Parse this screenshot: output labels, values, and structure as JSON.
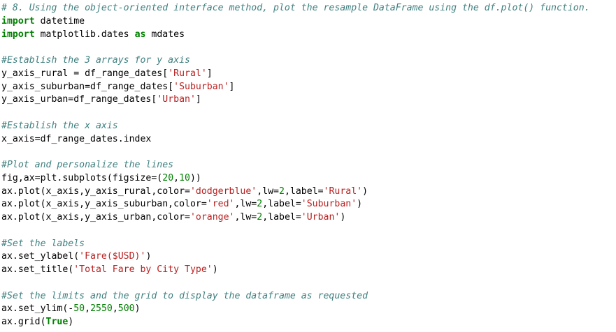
{
  "colors": {
    "comment": "#408080",
    "keyword": "#008000",
    "string": "#ba2121",
    "number": "#008000",
    "text": "#000000",
    "background": "#ffffff"
  },
  "code": {
    "lines": [
      [
        {
          "t": "comment",
          "v": "# 8. Using the object-oriented interface method, plot the resample DataFrame using the df.plot() function."
        }
      ],
      [
        {
          "t": "kw",
          "v": "import"
        },
        {
          "t": "name",
          "v": " datetime"
        }
      ],
      [
        {
          "t": "kw",
          "v": "import"
        },
        {
          "t": "name",
          "v": " matplotlib.dates "
        },
        {
          "t": "kw",
          "v": "as"
        },
        {
          "t": "name",
          "v": " mdates"
        }
      ],
      [],
      [
        {
          "t": "comment",
          "v": "#Establish the 3 arrays for y axis"
        }
      ],
      [
        {
          "t": "name",
          "v": "y_axis_rural = df_range_dates["
        },
        {
          "t": "str",
          "v": "'Rural'"
        },
        {
          "t": "name",
          "v": "]"
        }
      ],
      [
        {
          "t": "name",
          "v": "y_axis_suburban=df_range_dates["
        },
        {
          "t": "str",
          "v": "'Suburban'"
        },
        {
          "t": "name",
          "v": "]"
        }
      ],
      [
        {
          "t": "name",
          "v": "y_axis_urban=df_range_dates["
        },
        {
          "t": "str",
          "v": "'Urban'"
        },
        {
          "t": "name",
          "v": "]"
        }
      ],
      [],
      [
        {
          "t": "comment",
          "v": "#Establish the x axis"
        }
      ],
      [
        {
          "t": "name",
          "v": "x_axis=df_range_dates.index"
        }
      ],
      [],
      [
        {
          "t": "comment",
          "v": "#Plot and personalize the lines"
        }
      ],
      [
        {
          "t": "name",
          "v": "fig,ax=plt.subplots(figsize=("
        },
        {
          "t": "num",
          "v": "20"
        },
        {
          "t": "name",
          "v": ","
        },
        {
          "t": "num",
          "v": "10"
        },
        {
          "t": "name",
          "v": "))"
        }
      ],
      [
        {
          "t": "name",
          "v": "ax.plot(x_axis,y_axis_rural,color="
        },
        {
          "t": "str",
          "v": "'dodgerblue'"
        },
        {
          "t": "name",
          "v": ",lw="
        },
        {
          "t": "num",
          "v": "2"
        },
        {
          "t": "name",
          "v": ",label="
        },
        {
          "t": "str",
          "v": "'Rural'"
        },
        {
          "t": "name",
          "v": ")"
        }
      ],
      [
        {
          "t": "name",
          "v": "ax.plot(x_axis,y_axis_suburban,color="
        },
        {
          "t": "str",
          "v": "'red'"
        },
        {
          "t": "name",
          "v": ",lw="
        },
        {
          "t": "num",
          "v": "2"
        },
        {
          "t": "name",
          "v": ",label="
        },
        {
          "t": "str",
          "v": "'Suburban'"
        },
        {
          "t": "name",
          "v": ")"
        }
      ],
      [
        {
          "t": "name",
          "v": "ax.plot(x_axis,y_axis_urban,color="
        },
        {
          "t": "str",
          "v": "'orange'"
        },
        {
          "t": "name",
          "v": ",lw="
        },
        {
          "t": "num",
          "v": "2"
        },
        {
          "t": "name",
          "v": ",label="
        },
        {
          "t": "str",
          "v": "'Urban'"
        },
        {
          "t": "name",
          "v": ")"
        }
      ],
      [],
      [
        {
          "t": "comment",
          "v": "#Set the labels"
        }
      ],
      [
        {
          "t": "name",
          "v": "ax.set_ylabel("
        },
        {
          "t": "str",
          "v": "'Fare($USD)'"
        },
        {
          "t": "name",
          "v": ")"
        }
      ],
      [
        {
          "t": "name",
          "v": "ax.set_title("
        },
        {
          "t": "str",
          "v": "'Total Fare by City Type'"
        },
        {
          "t": "name",
          "v": ")"
        }
      ],
      [],
      [
        {
          "t": "comment",
          "v": "#Set the limits and the grid to display the dataframe as requested"
        }
      ],
      [
        {
          "t": "name",
          "v": "ax.set_ylim(-"
        },
        {
          "t": "num",
          "v": "50"
        },
        {
          "t": "name",
          "v": ","
        },
        {
          "t": "num",
          "v": "2550"
        },
        {
          "t": "name",
          "v": ","
        },
        {
          "t": "num",
          "v": "500"
        },
        {
          "t": "name",
          "v": ")"
        }
      ],
      [
        {
          "t": "name",
          "v": "ax.grid("
        },
        {
          "t": "kw",
          "v": "True"
        },
        {
          "t": "name",
          "v": ")"
        }
      ]
    ]
  }
}
